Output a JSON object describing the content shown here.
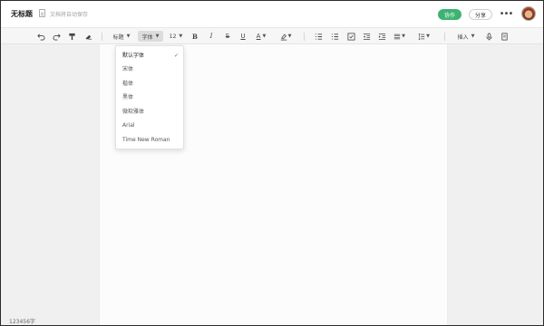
{
  "titlebar": {
    "title": "无标题",
    "save_status": "文档将自动保存",
    "collab_label": "协作",
    "share_label": "分享",
    "more_label": "•••"
  },
  "toolbar": {
    "heading_label": "标题",
    "font_label": "字体",
    "size_label": "12",
    "insert_label": "插入"
  },
  "font_menu": {
    "items": [
      {
        "label": "默认字体",
        "selected": true
      },
      {
        "label": "宋体",
        "selected": false
      },
      {
        "label": "楷体",
        "selected": false
      },
      {
        "label": "黑体",
        "selected": false
      },
      {
        "label": "微软雅体",
        "selected": false
      },
      {
        "label": "Arial",
        "selected": false
      },
      {
        "label": "Time New Roman",
        "selected": false
      }
    ],
    "check_mark": "✓"
  },
  "status": {
    "word_count": "123456字"
  },
  "colors": {
    "accent": "#3cb371"
  },
  "icons": [
    "undo-icon",
    "redo-icon",
    "format-painter-icon",
    "eraser-icon",
    "bold-icon",
    "italic-icon",
    "strikethrough-icon",
    "underline-icon",
    "font-color-icon",
    "highlight-icon",
    "bulleted-list-icon",
    "numbered-list-icon",
    "checklist-icon",
    "outdent-icon",
    "indent-icon",
    "align-icon",
    "line-spacing-icon",
    "microphone-icon",
    "document-icon"
  ]
}
